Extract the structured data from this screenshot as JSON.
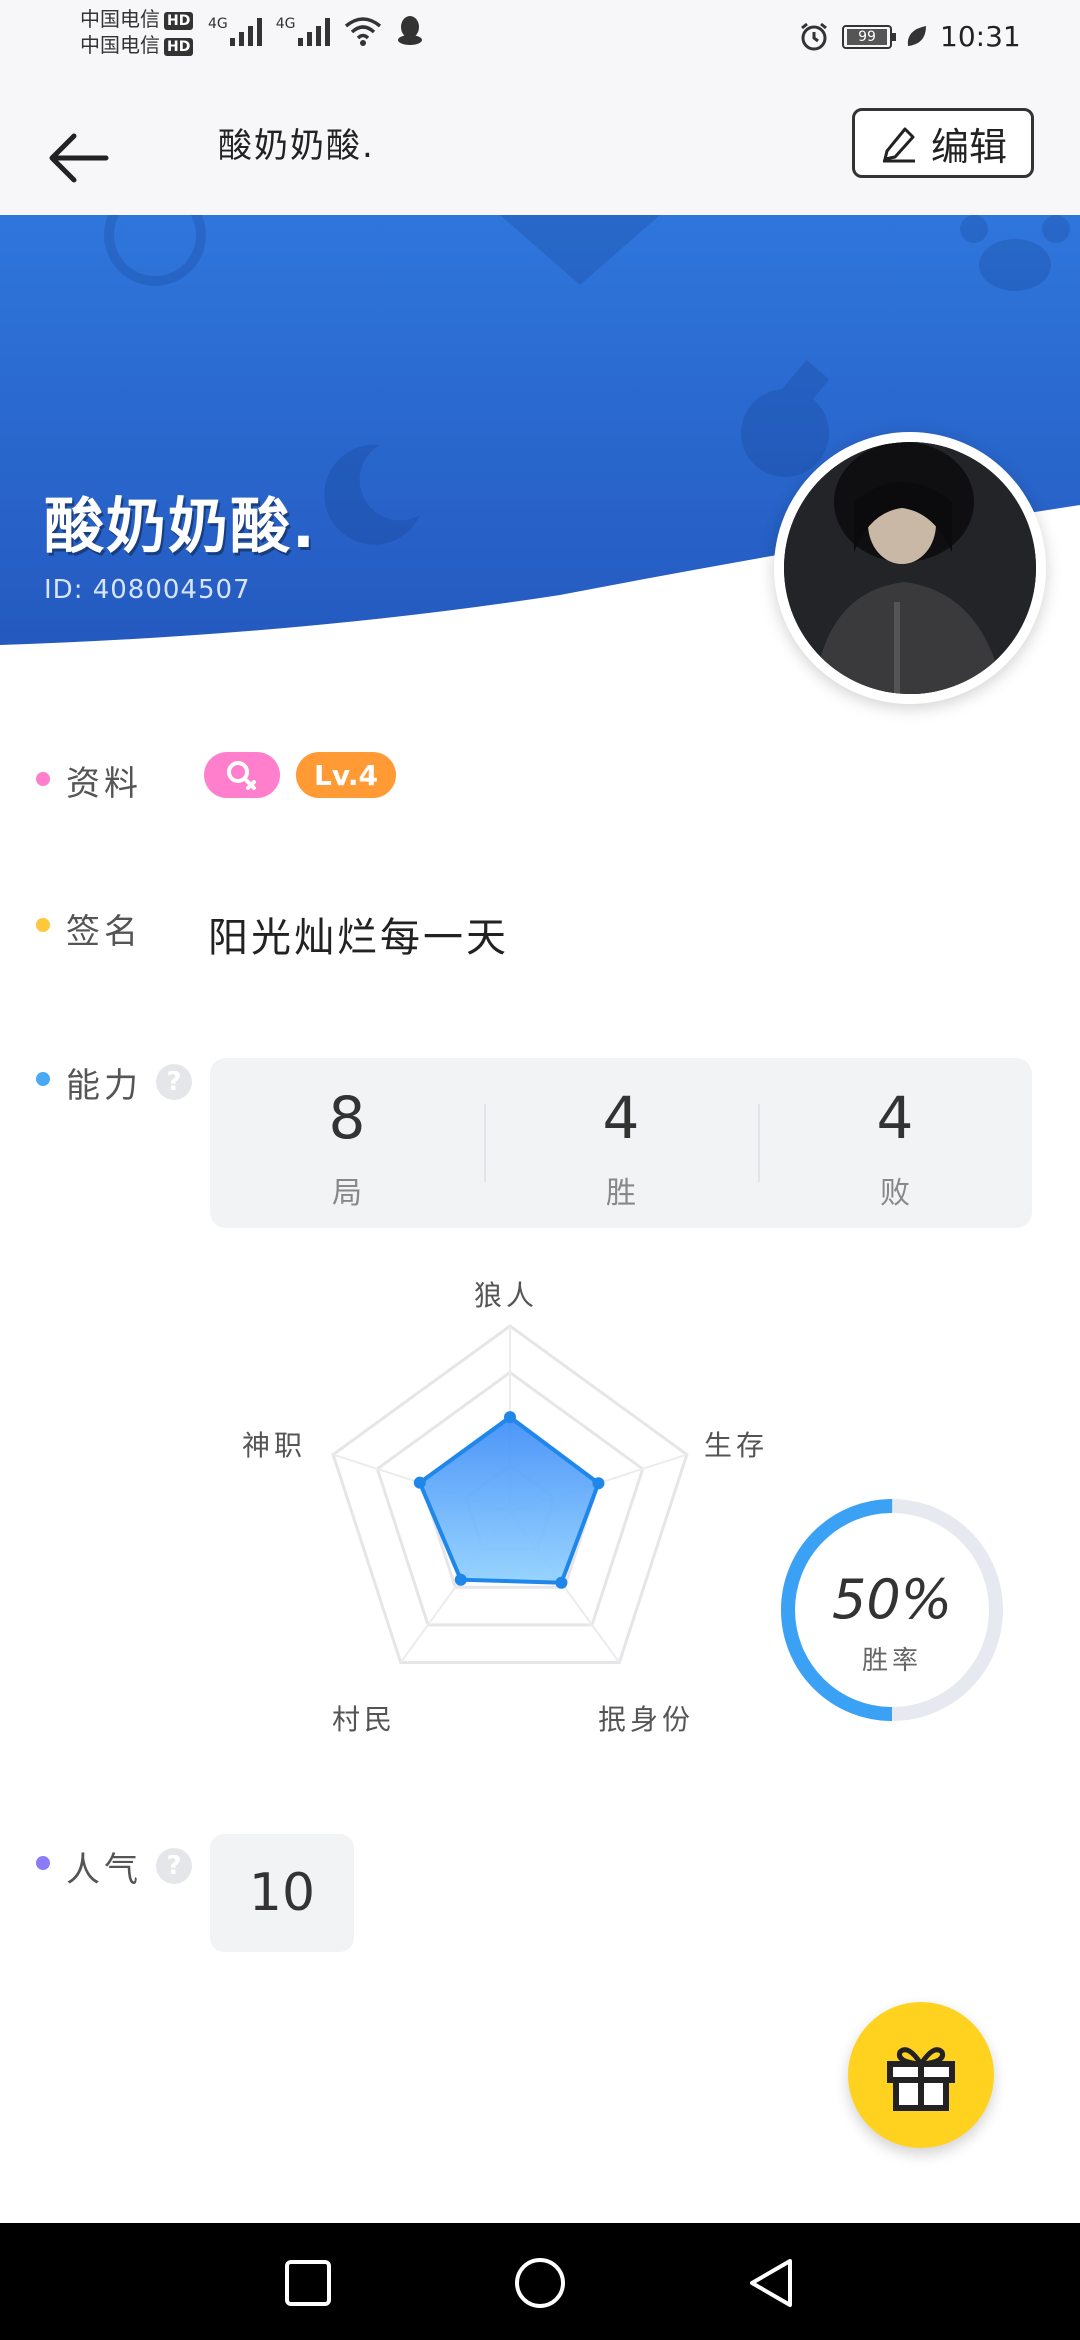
{
  "status_bar": {
    "carrier_1": "中国电信",
    "carrier_2": "中国电信",
    "hd_label": "HD",
    "network_1": "4G",
    "network_2": "4G",
    "battery": "99",
    "time": "10:31"
  },
  "header": {
    "title": "酸奶奶酸.",
    "edit_label": "编辑"
  },
  "profile": {
    "name": "酸奶奶酸.",
    "id_text": "ID: 408004507"
  },
  "info": {
    "label": "资料",
    "level": "Lv.4",
    "colors": {
      "gender_tag": "#ff7fcc",
      "level_tag": "#ff9a35",
      "dot": "#ff7fcc"
    }
  },
  "signature": {
    "label": "签名",
    "text": "阳光灿烂每一天",
    "dot_color": "#ffc83a"
  },
  "ability": {
    "label": "能力",
    "help": "?",
    "dot_color": "#4aa9f5",
    "stats": [
      {
        "value": "8",
        "label": "局"
      },
      {
        "value": "4",
        "label": "胜"
      },
      {
        "value": "4",
        "label": "败"
      }
    ],
    "radar": {
      "axes": [
        "狼人",
        "生存",
        "抿身份",
        "村民",
        "神职"
      ],
      "values": [
        0.51,
        0.5,
        0.47,
        0.45,
        0.51
      ],
      "fill_color": "#4f9cfa"
    },
    "win_rate": {
      "percent_text": "50%",
      "value": 0.5,
      "label": "胜率",
      "color": "#3aa1f5",
      "track_color": "#e6eaf0"
    }
  },
  "popularity": {
    "label": "人气",
    "help": "?",
    "value": "10",
    "dot_color": "#8b7cf6"
  }
}
